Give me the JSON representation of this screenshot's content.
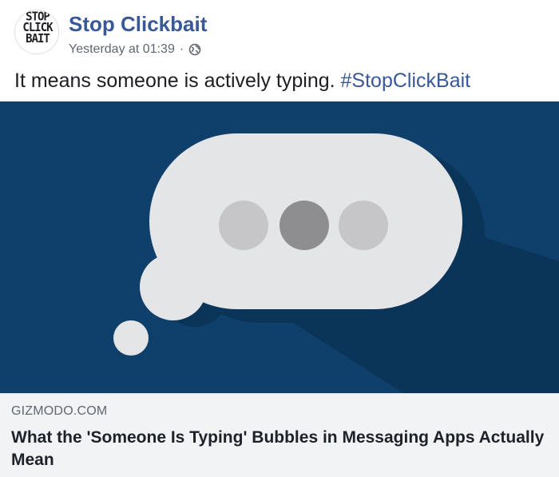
{
  "post": {
    "page_name": "Stop Clickbait",
    "timestamp": "Yesterday at 01:39",
    "separator": "·",
    "audience_icon": "globe-icon",
    "avatar": {
      "line1": "STOP",
      "line2": "CLICK",
      "line3": "BAIT"
    },
    "caption_text": "It means someone is actively typing.",
    "caption_hashtag": "#StopClickBait"
  },
  "link_preview": {
    "image_icon": "typing-speech-bubble",
    "domain": "GIZMODO.COM",
    "title": "What the 'Someone Is Typing' Bubbles in Messaging Apps Actually Mean"
  },
  "colors": {
    "link_blue": "#385898",
    "image_background": "#0f3f6b",
    "bubble": "#e4e5e7",
    "dot_light": "#c6c6c8",
    "dot_dark": "#8e8e91",
    "footer_background": "#f2f3f5"
  }
}
